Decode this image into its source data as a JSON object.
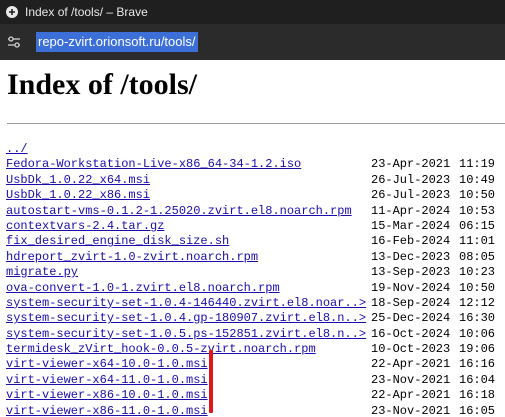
{
  "window": {
    "title": "Index of /tools/ – Brave"
  },
  "address_bar": {
    "url": "repo-zvirt.orionsoft.ru/tools/"
  },
  "page": {
    "heading": "Index of /tools/",
    "parent_link": "../",
    "entries": [
      {
        "name": "Fedora-Workstation-Live-x86_64-34-1.2.iso",
        "date": "23-Apr-2021",
        "time": "11:19"
      },
      {
        "name": "UsbDk_1.0.22_x64.msi",
        "date": "26-Jul-2023",
        "time": "10:49"
      },
      {
        "name": "UsbDk_1.0.22_x86.msi",
        "date": "26-Jul-2023",
        "time": "10:50"
      },
      {
        "name": "autostart-vms-0.1.2-1.25020.zvirt.el8.noarch.rpm",
        "date": "11-Apr-2024",
        "time": "10:53"
      },
      {
        "name": "contextvars-2.4.tar.gz",
        "date": "15-Mar-2024",
        "time": "06:15"
      },
      {
        "name": "fix_desired_engine_disk_size.sh",
        "date": "16-Feb-2024",
        "time": "11:01"
      },
      {
        "name": "hdreport_zvirt-1.0-zvirt.noarch.rpm",
        "date": "13-Dec-2023",
        "time": "08:05"
      },
      {
        "name": "migrate.py",
        "date": "13-Sep-2023",
        "time": "10:23"
      },
      {
        "name": "ova-convert-1.0-1.zvirt.el8.noarch.rpm",
        "date": "19-Nov-2024",
        "time": "10:50"
      },
      {
        "name": "system-security-set-1.0.4-146440.zvirt.el8.noar..>",
        "date": "18-Sep-2024",
        "time": "12:12"
      },
      {
        "name": "system-security-set-1.0.4.gp-180907.zvirt.el8.n..>",
        "date": "25-Dec-2024",
        "time": "16:30"
      },
      {
        "name": "system-security-set-1.0.5.ps-152851.zvirt.el8.n..>",
        "date": "16-Oct-2024",
        "time": "10:06"
      },
      {
        "name": "termidesk_zVirt_hook-0.0.5-zvirt.noarch.rpm",
        "date": "10-Oct-2023",
        "time": "19:06"
      },
      {
        "name": "virt-viewer-x64-10.0-1.0.msi",
        "date": "22-Apr-2021",
        "time": "16:16"
      },
      {
        "name": "virt-viewer-x64-11.0-1.0.msi",
        "date": "23-Nov-2021",
        "time": "16:04"
      },
      {
        "name": "virt-viewer-x86-10.0-1.0.msi",
        "date": "22-Apr-2021",
        "time": "16:18"
      },
      {
        "name": "virt-viewer-x86-11.0-1.0.msi",
        "date": "23-Nov-2021",
        "time": "16:05"
      }
    ]
  },
  "icons": {
    "app": "brave-app-icon",
    "site_settings": "tune-icon"
  },
  "colors": {
    "titlebar_bg": "#1f1f1f",
    "addressbar_bg": "#2b2b2b",
    "url_selection": "#3d6fd9",
    "link": "#1a0dab",
    "annotation_mark": "#e0161c"
  }
}
